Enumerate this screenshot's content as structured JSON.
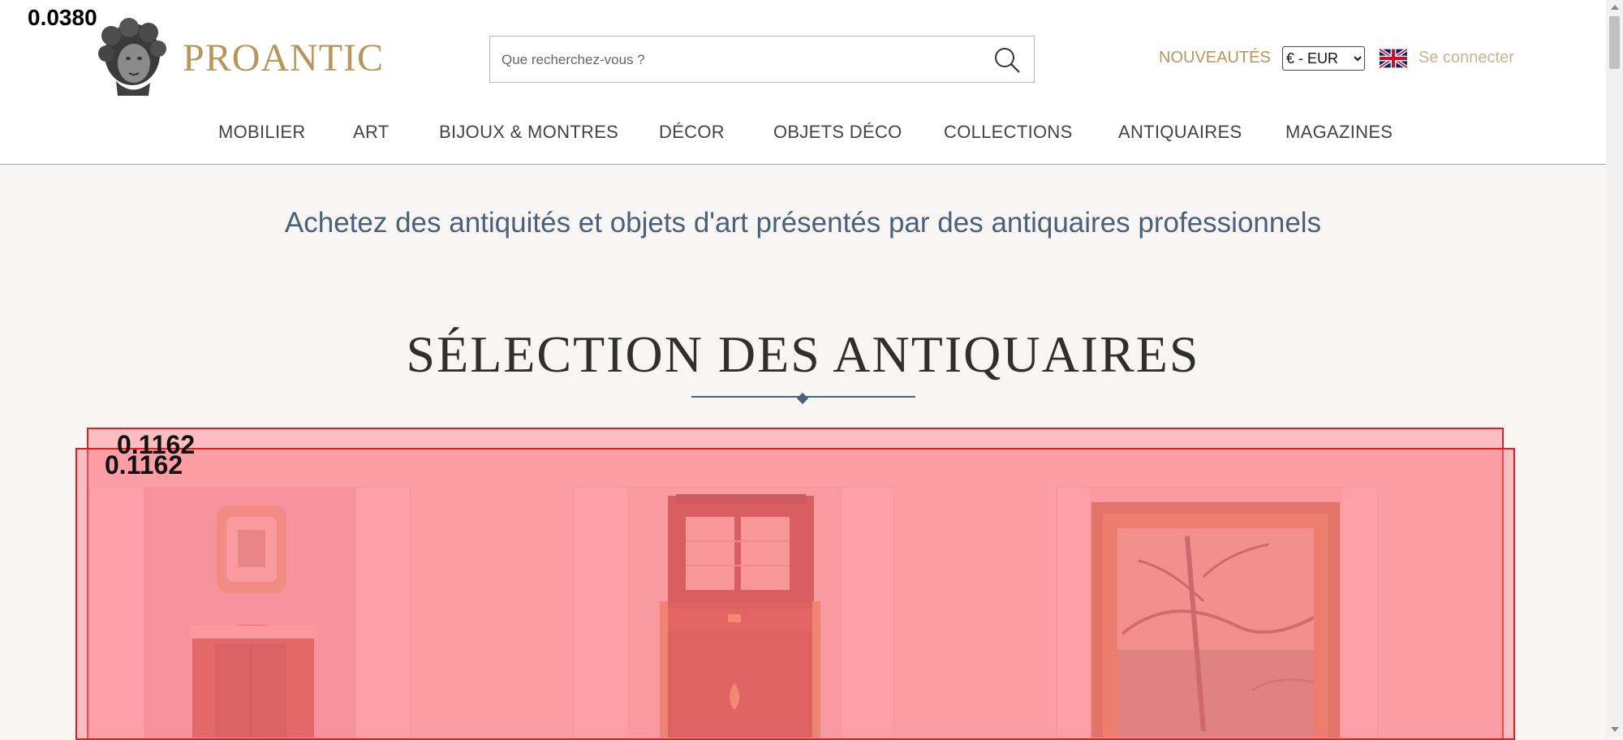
{
  "brand": {
    "name": "PROANTIC"
  },
  "search": {
    "placeholder": "Que recherchez-vous ?"
  },
  "header": {
    "new_label": "NOUVEAUTÉS",
    "currency": {
      "selected": "€ - EUR",
      "options": [
        "€ - EUR"
      ]
    },
    "login_label": "Se connecter"
  },
  "nav": {
    "items": [
      {
        "label": "MOBILIER"
      },
      {
        "label": "ART"
      },
      {
        "label": "BIJOUX & MONTRES"
      },
      {
        "label": "DÉCOR"
      },
      {
        "label": "OBJETS DÉCO"
      },
      {
        "label": "COLLECTIONS"
      },
      {
        "label": "ANTIQUAIRES"
      },
      {
        "label": "MAGAZINES"
      }
    ]
  },
  "main": {
    "tagline": "Achetez des antiquités et objets d'art présentés par des antiquaires professionnels",
    "section_title": "SÉLECTION DES ANTIQUAIRES"
  },
  "overlays": {
    "corner_label": "0.0380",
    "box1_label": "0.1162",
    "box2_label": "0.1162"
  },
  "colors": {
    "brand_gold": "#b8965a",
    "nav_text": "#444444",
    "accent_blue": "#4c6179",
    "overlay_red": "#e02020"
  }
}
